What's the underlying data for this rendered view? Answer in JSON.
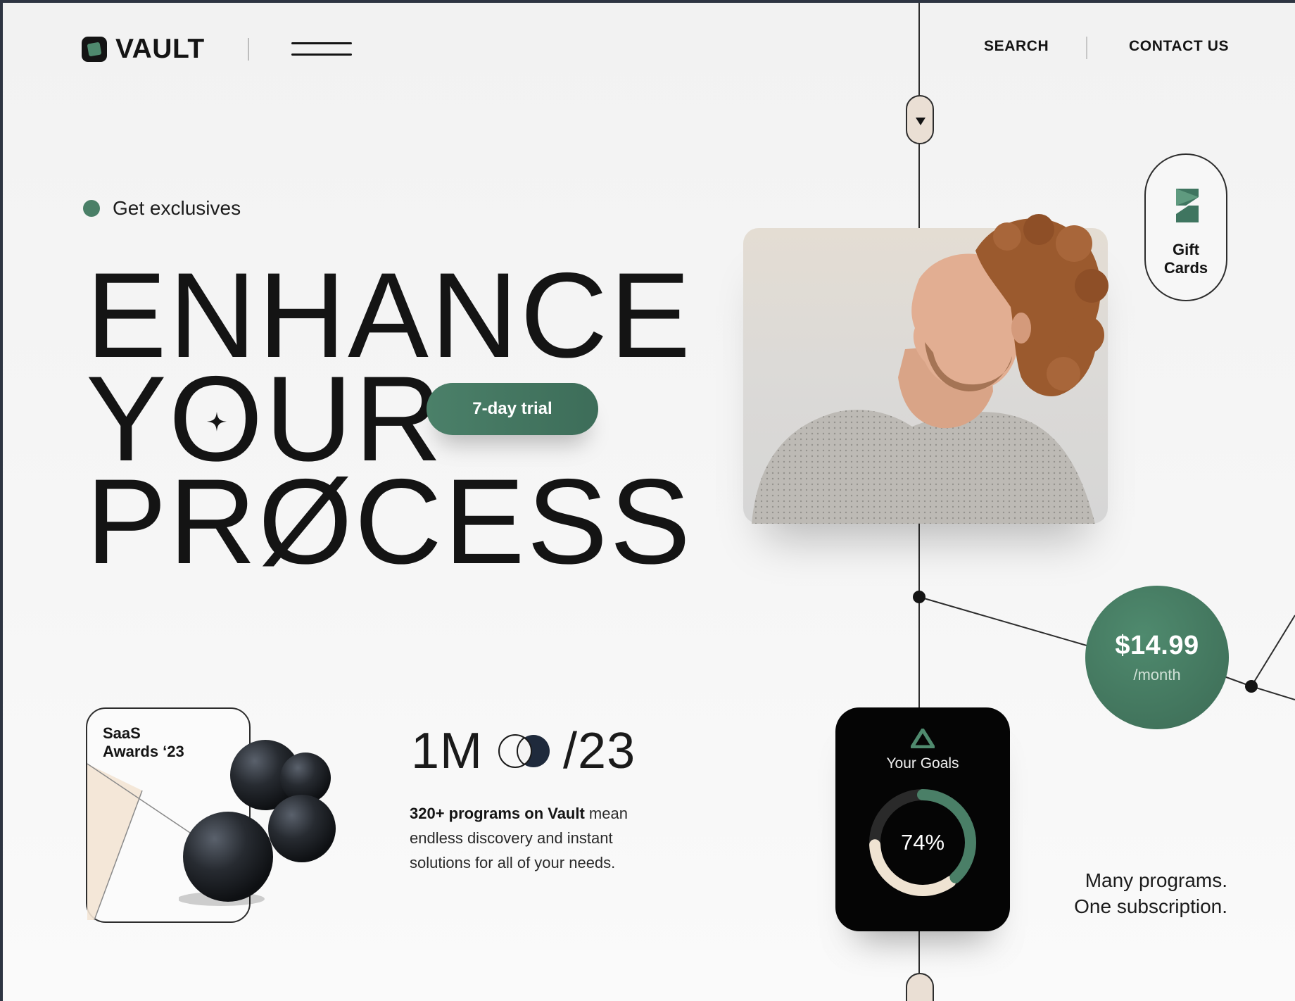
{
  "header": {
    "logo_text": "VAULT",
    "nav": {
      "search": "SEARCH",
      "contact": "CONTACT US"
    }
  },
  "hero": {
    "tag": "Get exclusives",
    "line1": "ENHANCE",
    "line2_a": "Y",
    "line2_o": "O",
    "line2_b": "UR",
    "line3": "PRØCESS",
    "trial_button": "7-day trial"
  },
  "gift_cards": {
    "label_line1": "Gift",
    "label_line2": "Cards"
  },
  "pricing": {
    "amount": "$14.99",
    "period": "/month"
  },
  "awards": {
    "title": "SaaS\nAwards ‘23"
  },
  "stats": {
    "users": "1M",
    "year": "/23",
    "description_bold": "320+ programs on Vault",
    "description_rest": " mean endless discovery and instant solutions for all of your needs."
  },
  "goals_widget": {
    "title": "Your Goals",
    "percent": "74%",
    "progress": 0.74
  },
  "tagline": {
    "line1": "Many programs.",
    "line2": "One subscription."
  },
  "colors": {
    "accent": "#4a7f67",
    "pill": "#eadfd4",
    "ink": "#141414"
  },
  "icons": [
    "logo-mark-icon",
    "menu-icon",
    "chevron-down-icon",
    "star-icon",
    "gift-logo-icon",
    "overlap-circles-icon",
    "triangle-logo-icon"
  ]
}
